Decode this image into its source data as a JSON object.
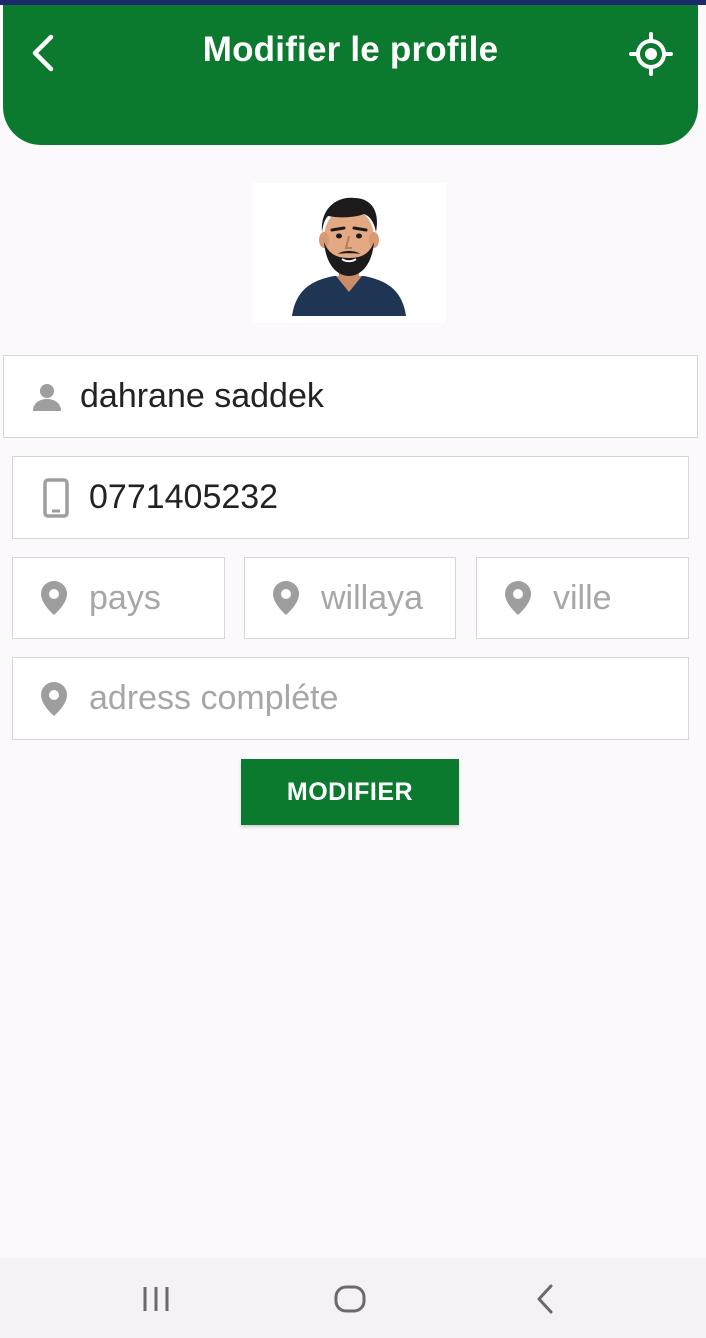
{
  "header": {
    "title": "Modifier le profile",
    "back_icon": "chevron-left-icon",
    "action_icon": "gps-locate-icon",
    "color": "#0b7a2e"
  },
  "avatar": {
    "icon": "user-avatar-illustration"
  },
  "form": {
    "name": {
      "icon": "person-icon",
      "value": "dahrane saddek",
      "placeholder": ""
    },
    "phone": {
      "icon": "smartphone-icon",
      "value": "0771405232",
      "placeholder": ""
    },
    "pays": {
      "icon": "location-pin-icon",
      "value": "",
      "placeholder": "pays"
    },
    "willaya": {
      "icon": "location-pin-icon",
      "value": "",
      "placeholder": "willaya"
    },
    "ville": {
      "icon": "location-pin-icon",
      "value": "",
      "placeholder": "ville"
    },
    "adress": {
      "icon": "location-pin-icon",
      "value": "",
      "placeholder": "adress compléte"
    },
    "submit_label": "MODIFIER"
  },
  "navbar": {
    "recents_icon": "recent-apps-icon",
    "home_icon": "home-icon",
    "back_icon": "system-back-icon"
  },
  "colors": {
    "primary": "#0b7a2e",
    "background": "#fcf9fc",
    "placeholder": "#a7a7a7",
    "icon_gray": "#9e9e9e"
  }
}
